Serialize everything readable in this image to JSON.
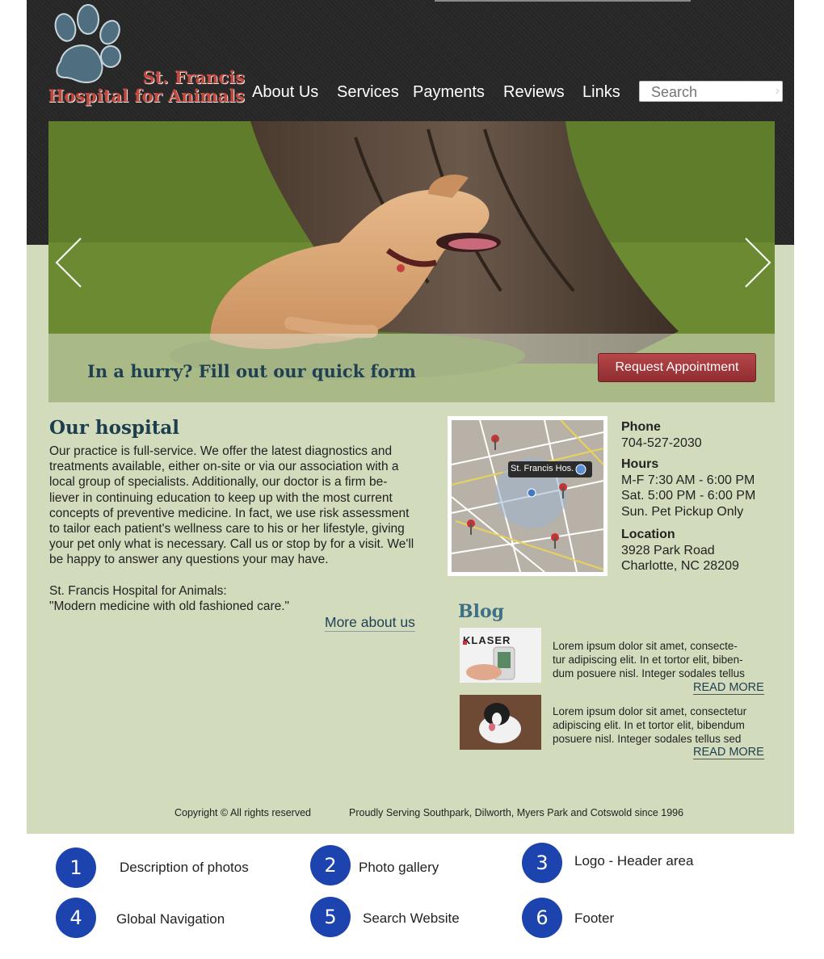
{
  "logo": {
    "line1": "St. Francis",
    "line2": "Hospital for Animals"
  },
  "nav": [
    "About Us",
    "Services",
    "Payments",
    "Reviews",
    "Links"
  ],
  "search": {
    "placeholder": "Search"
  },
  "hero": {
    "caption": "In a hurry? Fill out our quick form",
    "button": "Request Appointment"
  },
  "hospital": {
    "title": "Our hospital",
    "lines": [
      "Our practice is full-service. We offer the latest diagnostics and",
      "treatments available, either on-site or via our association with a",
      "local group of specialists. Additionally, our doctor is a firm be-",
      "liever in continuing education to keep up with the most current",
      "concepts of preventive medicine. In fact, we use risk assessment",
      "to tailor each patient's wellness care to his or her lifestyle, giving",
      "your pet only what is necessary. Call us or stop by for a visit. We'll",
      "be happy to answer any questions your may have."
    ],
    "tagline1": "St. Francis Hospital for Animals:",
    "tagline2": "\"Modern medicine with old fashioned care.\"",
    "more": "More about us"
  },
  "map": {
    "label": "St. Francis Hos."
  },
  "contact": {
    "phone_label": "Phone",
    "phone": "704-527-2030",
    "hours_label": "Hours",
    "hours": [
      "M-F 7:30 AM - 6:00 PM",
      "Sat. 5:00 PM - 6:00 PM",
      "Sun. Pet Pickup Only"
    ],
    "location_label": "Location",
    "address1": "3928 Park Road",
    "address2": "Charlotte, NC 28209"
  },
  "blog": {
    "title": "Blog",
    "posts": [
      {
        "lines": [
          "Lorem ipsum dolor sit amet, consecte-",
          "tur adipiscing elit. In et tortor elit, biben-",
          "dum posuere nisl. Integer sodales tellus"
        ],
        "read_more": "READ MORE",
        "thumb_text": "KLASER"
      },
      {
        "lines": [
          "Lorem ipsum dolor sit amet, consectetur",
          "adipiscing elit. In et tortor elit, bibendum",
          "posuere nisl. Integer sodales tellus sed"
        ],
        "read_more": "READ MORE"
      }
    ]
  },
  "footer": {
    "copyright": "Copyright © All rights reserved",
    "serving": "Proudly Serving Southpark, Dilworth, Myers Park and Cotswold since 1996"
  },
  "legend": [
    {
      "num": "1",
      "label": "Description of photos"
    },
    {
      "num": "2",
      "label": "Photo gallery"
    },
    {
      "num": "3",
      "label": "Logo - Header area"
    },
    {
      "num": "4",
      "label": "Global Navigation"
    },
    {
      "num": "5",
      "label": "Search Website"
    },
    {
      "num": "6",
      "label": "Footer"
    }
  ],
  "colors": {
    "page_bg": "#d2dcbc",
    "header_bg": "#2b2b2b",
    "logo": "#c0483d",
    "heading": "#1d3e4f",
    "button": "#a23b3f",
    "legend_circle": "#1c43ae"
  }
}
